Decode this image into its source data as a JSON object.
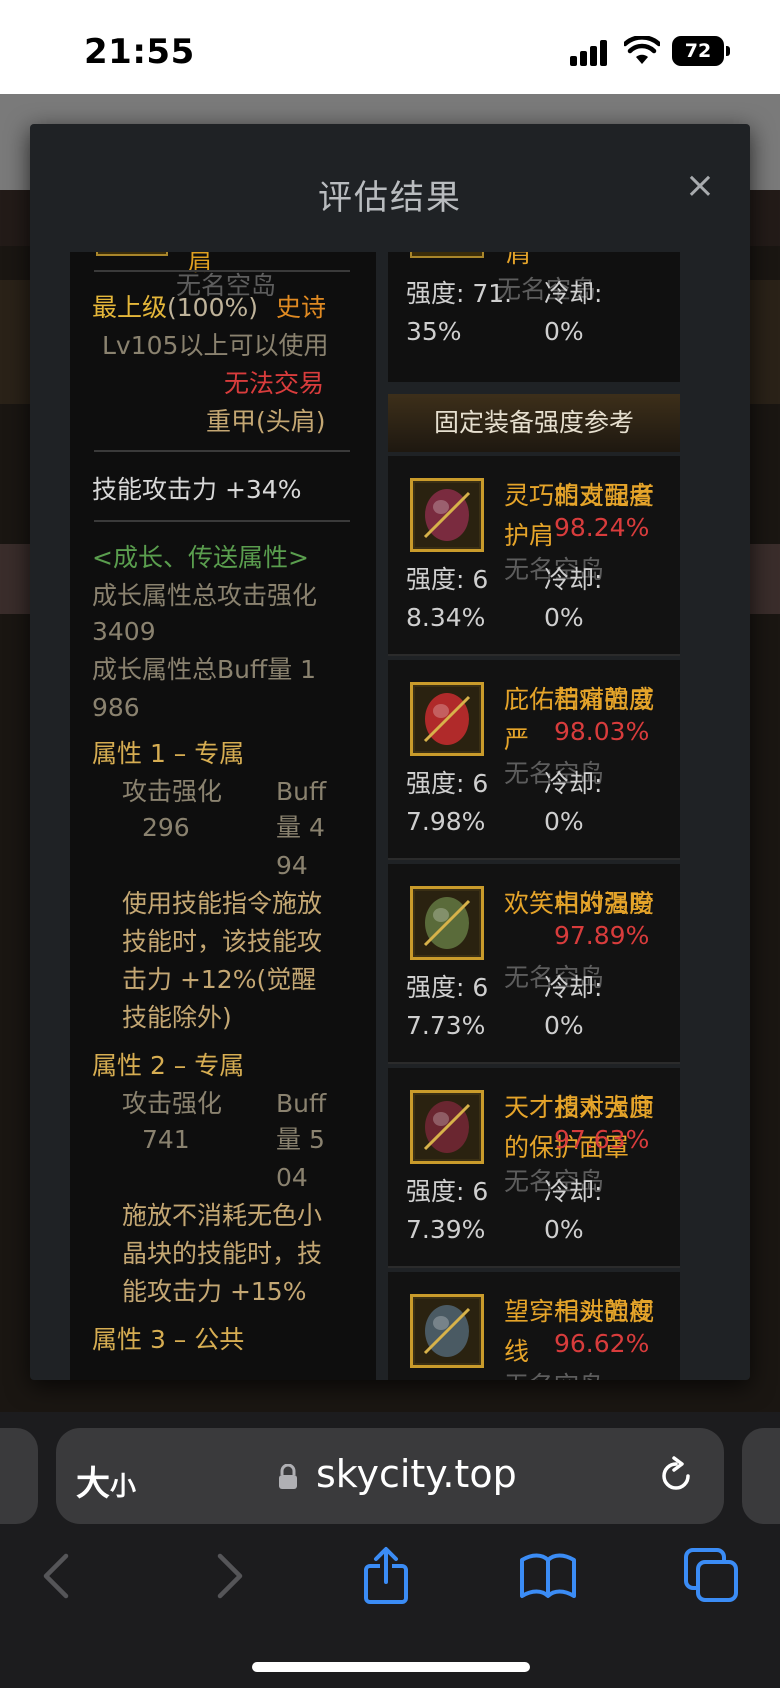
{
  "status_bar": {
    "time": "21:55",
    "battery": "72"
  },
  "modal": {
    "title": "评估结果",
    "close_symbol": "×",
    "watermark": "无名空岛",
    "left_panel": {
      "top_name_fragment": "肩",
      "grade": "最上级",
      "grade_pct": "(100%)",
      "rarity": "史诗",
      "level_req": "Lv105以上可以使用",
      "trade": "无法交易",
      "type": "重甲(头肩)",
      "skill_atk": "技能攻击力  +34%",
      "growth_header": "<成长、传送属性>",
      "growth_atk_label": "成长属性总攻击强化",
      "growth_atk_value": "3409",
      "growth_buff_label": "成长属性总Buff量 1",
      "growth_buff_value": "986",
      "attr1_title": "属性 1 – 专属",
      "attr1_atk_label": "攻击强化",
      "attr1_atk_value": "296",
      "attr1_buff_line1": "Buff",
      "attr1_buff_line2": "量  4",
      "attr1_buff_line3": "94",
      "attr1_desc": [
        "使用技能指令施放",
        "技能时，该技能攻",
        "击力 +12%(觉醒",
        "技能除外)"
      ],
      "attr2_title": "属性 2 – 专属",
      "attr2_atk_label": "攻击强化",
      "attr2_atk_value": "741",
      "attr2_buff_line1": "Buff",
      "attr2_buff_line2": "量  5",
      "attr2_buff_line3": "04",
      "attr2_desc": [
        "施放不消耗无色小",
        "晶块的技能时，技",
        "能攻击力 +15%"
      ],
      "attr3_title": "属性 3 – 公共"
    },
    "right_top": {
      "name_fragment": "肩",
      "strength_line1": "强度: 71.",
      "strength_line2": "35%",
      "cooldown_label": "冷却:",
      "cooldown_value": "0%"
    },
    "reference_header": "固定装备强度参考",
    "rel_label": "相对强度",
    "strength_prefix": "强度: 6",
    "cooldown_label": "冷却:",
    "cooldown_value": "0%",
    "cards": [
      {
        "name": "灵巧的支配者护肩",
        "relative": "98.24%",
        "strength_rest": "8.34%",
        "icon": "shoulder-armor-icon",
        "color": "#7a2b3f"
      },
      {
        "name": "庇佑苦痛的威严",
        "relative": "98.03%",
        "strength_rest": "7.98%",
        "icon": "red-cape-icon",
        "color": "#b02a2a"
      },
      {
        "name": "欢笑中的渴盼",
        "relative": "97.89%",
        "strength_rest": "7.73%",
        "icon": "goblin-armor-icon",
        "color": "#5a6b3a"
      },
      {
        "name": "天才技术大师的保护面罩",
        "relative": "97.63%",
        "strength_rest": "7.39%",
        "icon": "mask-icon",
        "color": "#6a2630"
      },
      {
        "name": "望穿千头的视线",
        "relative": "96.62%",
        "strength_rest": "",
        "icon": "horned-helm-icon",
        "color": "#4a5a63"
      }
    ]
  },
  "browser": {
    "text_size_label": "大",
    "text_size_small": "小",
    "url": "skycity.top"
  }
}
